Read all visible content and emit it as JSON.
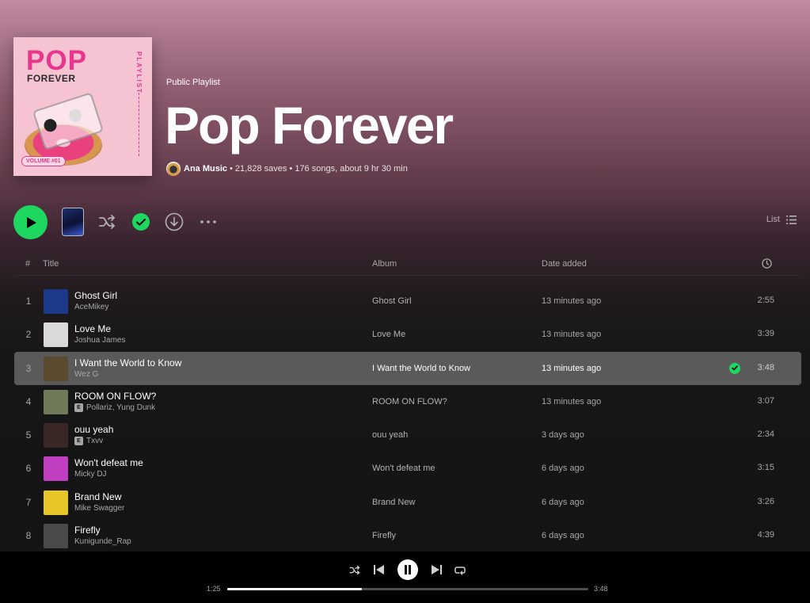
{
  "playlist": {
    "type": "Public Playlist",
    "title": "Pop Forever",
    "owner": "Ana Music",
    "meta": "• 21,828 saves • 176 songs, about 9 hr 30 min",
    "cover": {
      "big_text": "POP",
      "sub_text": "FOREVER",
      "side_text": "PLAYLIST",
      "volume": "VOLUME #01"
    }
  },
  "actions": {
    "list_label": "List",
    "icons": [
      "play-icon",
      "shuffle-icon",
      "saved-check-icon",
      "download-icon",
      "more-icon",
      "list-view-icon"
    ]
  },
  "table": {
    "headers": {
      "num": "#",
      "title": "Title",
      "album": "Album",
      "date_added": "Date added",
      "duration_icon": "clock-icon"
    }
  },
  "tracks": [
    {
      "num": "1",
      "title": "Ghost Girl",
      "artist": "AceMikey",
      "explicit": false,
      "album": "Ghost Girl",
      "added": "13 minutes ago",
      "duration": "2:55",
      "thumb_color": "#1d3a8a",
      "active": false,
      "saved": false
    },
    {
      "num": "2",
      "title": "Love Me",
      "artist": "Joshua James",
      "explicit": false,
      "album": "Love Me",
      "added": "13 minutes ago",
      "duration": "3:39",
      "thumb_color": "#d9d9d9",
      "active": false,
      "saved": false
    },
    {
      "num": "3",
      "title": "I Want the World to Know",
      "artist": "Wez G",
      "explicit": false,
      "album": "I Want the World to Know",
      "added": "13 minutes ago",
      "duration": "3:48",
      "thumb_color": "#5a4a2e",
      "active": true,
      "saved": true
    },
    {
      "num": "4",
      "title": "ROOM ON FLOW?",
      "artist": "Pollariz, Yung Dunk",
      "explicit": true,
      "album": "ROOM ON FLOW?",
      "added": "13 minutes ago",
      "duration": "3:07",
      "thumb_color": "#6f7a5a",
      "active": false,
      "saved": false
    },
    {
      "num": "5",
      "title": "ouu yeah",
      "artist": "Txvv",
      "explicit": true,
      "album": "ouu yeah",
      "added": "3 days ago",
      "duration": "2:34",
      "thumb_color": "#3a2826",
      "active": false,
      "saved": false
    },
    {
      "num": "6",
      "title": "Won't defeat me",
      "artist": "Micky DJ",
      "explicit": false,
      "album": "Won't defeat me",
      "added": "6 days ago",
      "duration": "3:15",
      "thumb_color": "#c03fc0",
      "active": false,
      "saved": false
    },
    {
      "num": "7",
      "title": "Brand New",
      "artist": "Mike Swagger",
      "explicit": false,
      "album": "Brand New",
      "added": "6 days ago",
      "duration": "3:26",
      "thumb_color": "#e6c629",
      "active": false,
      "saved": false
    },
    {
      "num": "8",
      "title": "Firefly",
      "artist": "Kunigunde_Rap",
      "explicit": false,
      "album": "Firefly",
      "added": "6 days ago",
      "duration": "4:39",
      "thumb_color": "#4a4a4a",
      "active": false,
      "saved": false
    }
  ],
  "explicit_label": "E",
  "player": {
    "elapsed": "1:25",
    "total": "3:48",
    "progress": 0.373,
    "icons": [
      "shuffle-icon",
      "previous-icon",
      "pause-icon",
      "next-icon",
      "repeat-icon"
    ]
  }
}
